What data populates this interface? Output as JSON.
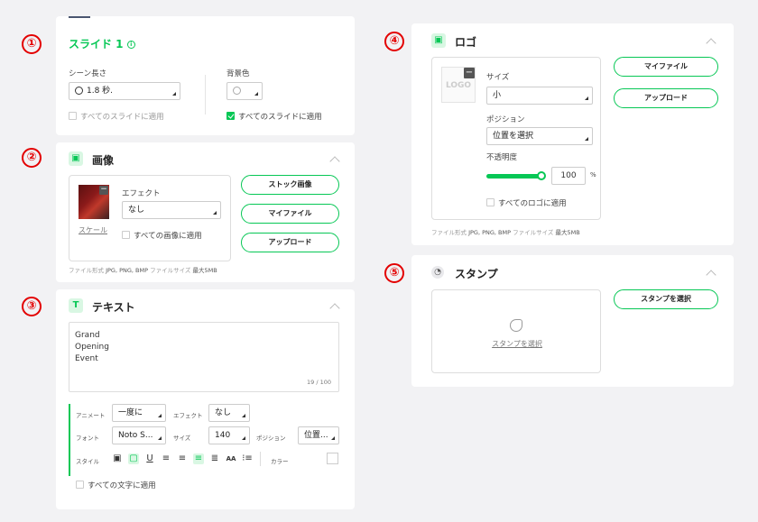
{
  "markers": [
    "①",
    "②",
    "③",
    "④",
    "⑤"
  ],
  "slide": {
    "title": "スライド 1",
    "info_icon": "info-icon",
    "scene_length_label": "シーン長さ",
    "scene_length_value": "1.8 秒.",
    "bg_color_label": "背景色",
    "apply_all_left": "すべてのスライドに適用",
    "apply_all_right": "すべてのスライドに適用",
    "apply_all_right_checked": true,
    "accent": "#06c755"
  },
  "image": {
    "title": "画像",
    "effect_label": "エフェクト",
    "effect_value": "なし",
    "scale_link": "スケール",
    "apply_all": "すべての画像に適用",
    "stock_button": "ストック画像",
    "myfile_button": "マイファイル",
    "upload_button": "アップロード",
    "file_format_label": "ファイル形式",
    "file_formats": "JPG, PNG, BMP",
    "file_size_label": "ファイルサイズ",
    "file_size_value": "最大5MB"
  },
  "text": {
    "title": "テキスト",
    "content": "Grand\nOpening\nEvent",
    "counter": "19 / 100",
    "animate_label": "アニメート",
    "animate_value": "一度に",
    "effect_label": "エフェクト",
    "effect_value": "なし",
    "font_label": "フォント",
    "font_value": "Noto S...",
    "size_label": "サイズ",
    "size_value": "140",
    "position_label": "ポジション",
    "position_value": "位置...",
    "style_label": "スタイル",
    "color_label": "カラー",
    "apply_all": "すべての文字に適用"
  },
  "logo": {
    "title": "ロゴ",
    "preview_text": "LOGO",
    "size_label": "サイズ",
    "size_value": "小",
    "position_label": "ポジション",
    "position_value": "位置を選択",
    "opacity_label": "不透明度",
    "opacity_value": "100",
    "opacity_unit": "%",
    "opacity_fraction": 1.0,
    "apply_all": "すべてのロゴに適用",
    "myfile_button": "マイファイル",
    "upload_button": "アップロード",
    "file_format_label": "ファイル形式",
    "file_formats": "JPG, PNG, BMP",
    "file_size_label": "ファイルサイズ",
    "file_size_value": "最大5MB"
  },
  "stamp": {
    "title": "スタンプ",
    "select_link": "スタンプを選択",
    "select_button": "スタンプを選択"
  }
}
